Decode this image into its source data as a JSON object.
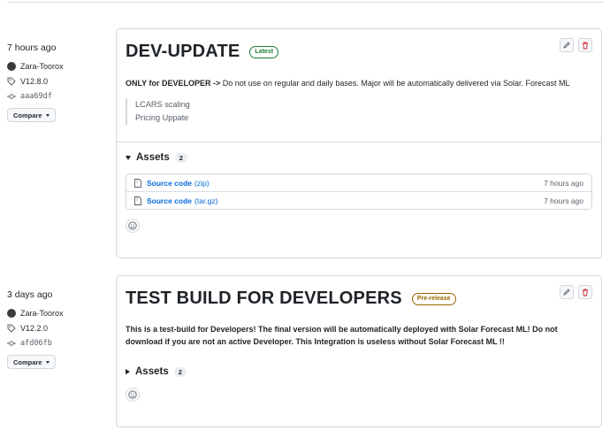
{
  "releases": [
    {
      "sidebar": {
        "time": "7 hours ago",
        "author": "Zara-Toorox",
        "tag": "V12.8.0",
        "commit": "aaa69df",
        "compare_label": "Compare"
      },
      "title": "DEV-UPDATE",
      "badge": "Latest",
      "desc_bold": "ONLY for DEVELOPER ->",
      "desc_rest": " Do not use on regular and daily bases. Major will be automatically delivered via Solar. Forecast ML",
      "quote": [
        "LCARS scaling",
        "Pricing Uppate"
      ],
      "assets_label": "Assets",
      "assets_count": "2",
      "assets": [
        {
          "name": "Source code",
          "ext": "(zip)",
          "time": "7 hours ago"
        },
        {
          "name": "Source code",
          "ext": "(tar.gz)",
          "time": "7 hours ago"
        }
      ]
    },
    {
      "sidebar": {
        "time": "3 days ago",
        "author": "Zara-Toorox",
        "tag": "V12.2.0",
        "commit": "afd06fb",
        "compare_label": "Compare"
      },
      "title": "TEST BUILD FOR DEVELOPERS",
      "badge": "Pre-release",
      "desc": "This is a test-build for Developers! The final version will be automatically deployed with Solar Forecast ML! Do not download if you are not an active Developer. This Integration is useless without Solar Forecast ML !!",
      "assets_label": "Assets",
      "assets_count": "2"
    }
  ],
  "colors": {
    "link": "#0969da",
    "latest": "#1a7f37",
    "prerelease": "#9a6700",
    "delete": "#cf222e"
  },
  "icons": [
    "person-avatar",
    "tag-icon",
    "commit-icon",
    "pencil-icon",
    "trash-icon",
    "file-zip-icon",
    "smiley-icon"
  ]
}
